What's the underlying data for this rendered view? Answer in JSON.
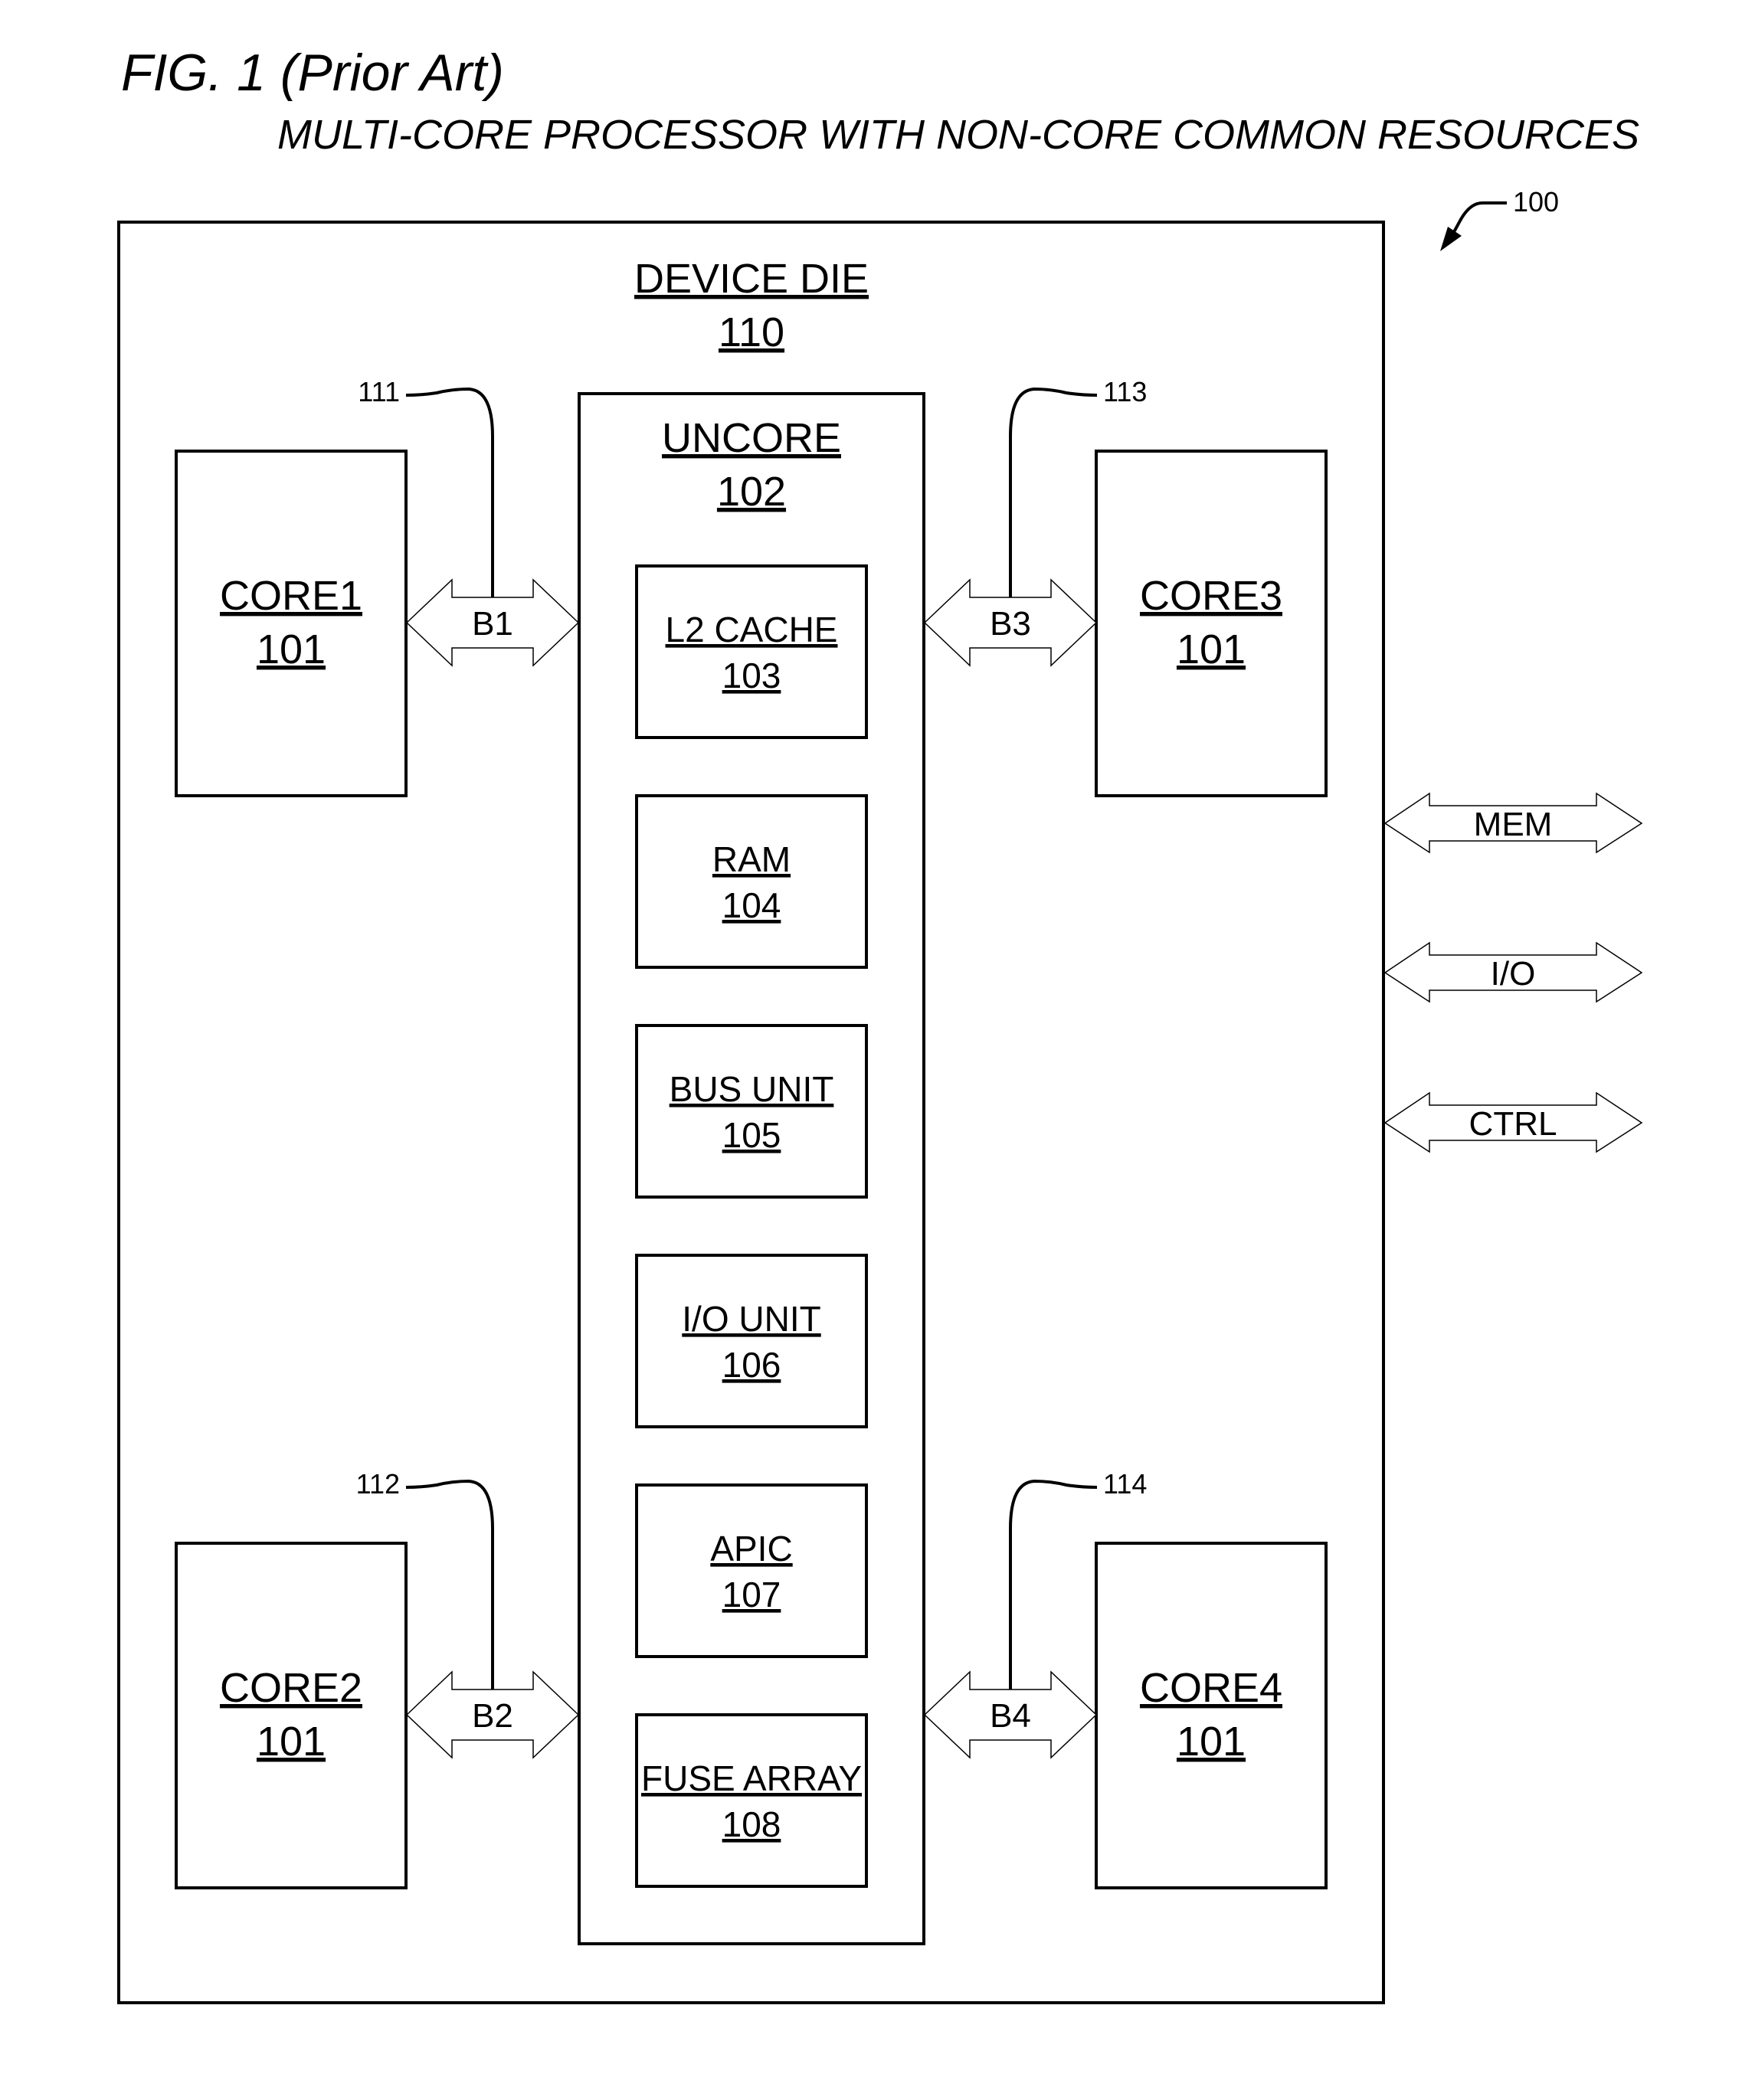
{
  "figure": {
    "title": "FIG. 1 (Prior Art)",
    "subtitle": "MULTI-CORE PROCESSOR WITH NON-CORE COMMON RESOURCES",
    "ref": "100"
  },
  "device_die": {
    "name": "DEVICE DIE",
    "ref": "110"
  },
  "uncore": {
    "name": "UNCORE",
    "ref": "102",
    "units": [
      {
        "name": "L2 CACHE",
        "ref": "103"
      },
      {
        "name": "RAM",
        "ref": "104"
      },
      {
        "name": "BUS UNIT",
        "ref": "105"
      },
      {
        "name": "I/O UNIT",
        "ref": "106"
      },
      {
        "name": "APIC",
        "ref": "107"
      },
      {
        "name": "FUSE ARRAY",
        "ref": "108"
      }
    ]
  },
  "cores": [
    {
      "name": "CORE1",
      "ref": "101"
    },
    {
      "name": "CORE2",
      "ref": "101"
    },
    {
      "name": "CORE3",
      "ref": "101"
    },
    {
      "name": "CORE4",
      "ref": "101"
    }
  ],
  "buses": [
    {
      "label": "B1",
      "ref": "111"
    },
    {
      "label": "B2",
      "ref": "112"
    },
    {
      "label": "B3",
      "ref": "113"
    },
    {
      "label": "B4",
      "ref": "114"
    }
  ],
  "external_interfaces": [
    {
      "label": "MEM"
    },
    {
      "label": "I/O"
    },
    {
      "label": "CTRL"
    }
  ]
}
